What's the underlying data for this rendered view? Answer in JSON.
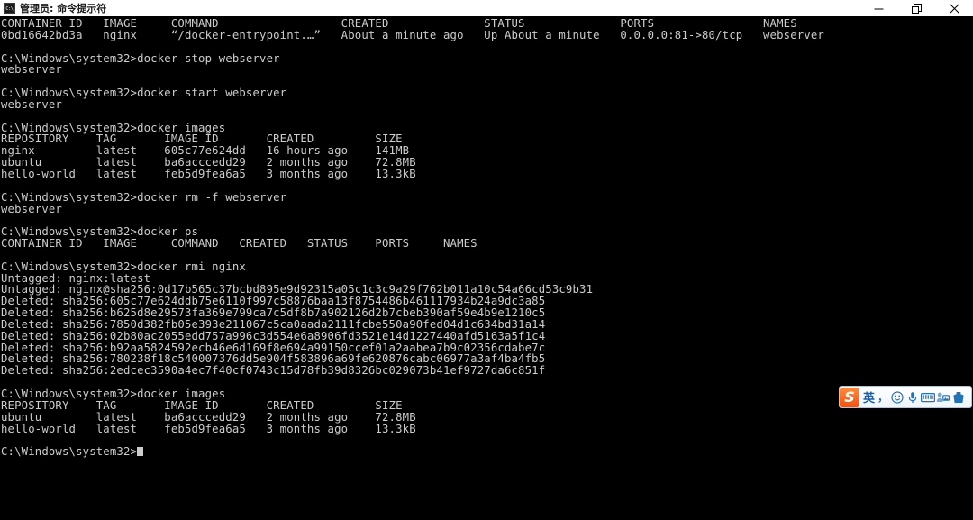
{
  "window": {
    "title": "管理员: 命令提示符",
    "icon": "cmd-console-icon",
    "icon_label": "C:\\",
    "controls": {
      "minimize": "minimize-button",
      "restore": "restore-button",
      "close": "close-button"
    }
  },
  "terminal": {
    "background_color": "#000000",
    "foreground_color": "#cccccc",
    "prompt": "C:\\Windows\\system32>",
    "lines": [
      "CONTAINER ID   IMAGE     COMMAND                  CREATED              STATUS              PORTS                NAMES",
      "0bd16642bd3a   nginx     “/docker-entrypoint.…”   About a minute ago   Up About a minute   0.0.0.0:81->80/tcp   webserver",
      "",
      "C:\\Windows\\system32>docker stop webserver",
      "webserver",
      "",
      "C:\\Windows\\system32>docker start webserver",
      "webserver",
      "",
      "C:\\Windows\\system32>docker images",
      "REPOSITORY    TAG       IMAGE ID       CREATED         SIZE",
      "nginx         latest    605c77e624dd   16 hours ago    141MB",
      "ubuntu        latest    ba6acccedd29   2 months ago    72.8MB",
      "hello-world   latest    feb5d9fea6a5   3 months ago    13.3kB",
      "",
      "C:\\Windows\\system32>docker rm -f webserver",
      "webserver",
      "",
      "C:\\Windows\\system32>docker ps",
      "CONTAINER ID   IMAGE     COMMAND   CREATED   STATUS    PORTS     NAMES",
      "",
      "C:\\Windows\\system32>docker rmi nginx",
      "Untagged: nginx:latest",
      "Untagged: nginx@sha256:0d17b565c37bcbd895e9d92315a05c1c3c9a29f762b011a10c54a66cd53c9b31",
      "Deleted: sha256:605c77e624ddb75e6110f997c58876baa13f8754486b461117934b24a9dc3a85",
      "Deleted: sha256:b625d8e29573fa369e799ca7c5df8b7a902126d2b7cbeb390af59e4b9e1210c5",
      "Deleted: sha256:7850d382fb05e393e211067c5ca0aada2111fcbe550a90fed04d1c634bd31a14",
      "Deleted: sha256:02b80ac2055edd757a996c3d554e6a8906fd3521e14d1227440afd5163a5f1c4",
      "Deleted: sha256:b92aa5824592ecb46e6d169f8e694a99150ccef01a2aabea7b9c02356cdabe7c",
      "Deleted: sha256:780238f18c540007376dd5e904f583896a69fe620876cabc06977a3af4ba4fb5",
      "Deleted: sha256:2edcec3590a4ec7f40cf0743c15d78fb39d8326bc029073b41ef9727da6c851f",
      "",
      "C:\\Windows\\system32>docker images",
      "REPOSITORY    TAG       IMAGE ID       CREATED         SIZE",
      "ubuntu        latest    ba6acccedd29   2 months ago    72.8MB",
      "hello-world   latest    feb5d9fea6a5   3 months ago    13.3kB",
      "",
      "C:\\Windows\\system32>"
    ]
  },
  "ime_toolbar": {
    "name": "sogou-input-method-toolbar",
    "logo_label": "S",
    "mode_label": "英",
    "punctuation_label": "，",
    "items": [
      {
        "name": "sogou-logo-icon",
        "label": "S"
      },
      {
        "name": "input-mode-english-button",
        "label": "英"
      },
      {
        "name": "punctuation-toggle-button",
        "label": "，"
      },
      {
        "name": "emoji-icon",
        "label": ""
      },
      {
        "name": "microphone-icon",
        "label": ""
      },
      {
        "name": "soft-keyboard-icon",
        "label": ""
      },
      {
        "name": "skin-change-icon",
        "label": ""
      },
      {
        "name": "toolbox-icon",
        "label": ""
      }
    ]
  }
}
